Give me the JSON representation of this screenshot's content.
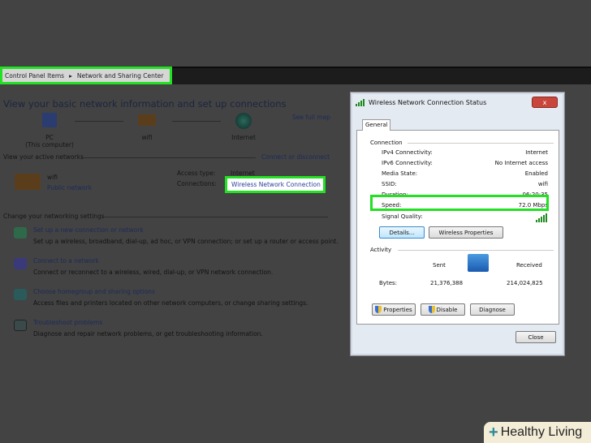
{
  "breadcrumb": {
    "items": [
      "Control Panel Items",
      "Network and Sharing Center"
    ]
  },
  "main": {
    "title": "View your basic network information and set up connections",
    "map": {
      "nodes": [
        {
          "label": "PC",
          "sub": "(This computer)"
        },
        {
          "label": "wifi"
        },
        {
          "label": "Internet"
        }
      ],
      "see_full_map": "See full map"
    },
    "active": {
      "heading": "View your active networks",
      "connect_link": "Connect or disconnect",
      "network_name": "wifi",
      "network_type": "Public network",
      "access_label": "Access type:",
      "access_value": "Internet",
      "connections_label": "Connections:",
      "connection_link": "Wireless Network Connection"
    },
    "change": {
      "heading": "Change your networking settings",
      "items": [
        {
          "title": "Set up a new connection or network",
          "desc": "Set up a wireless, broadband, dial-up, ad hoc, or VPN connection; or set up a router or access point."
        },
        {
          "title": "Connect to a network",
          "desc": "Connect or reconnect to a wireless, wired, dial-up, or VPN network connection."
        },
        {
          "title": "Choose homegroup and sharing options",
          "desc": "Access files and printers located on other network computers, or change sharing settings."
        },
        {
          "title": "Troubleshoot problems",
          "desc": "Diagnose and repair network problems, or get troubleshooting information."
        }
      ]
    }
  },
  "dialog": {
    "title": "Wireless Network Connection Status",
    "close_x": "x",
    "tab": "General",
    "connection_heading": "Connection",
    "rows": [
      {
        "label": "IPv4 Connectivity:",
        "value": "Internet"
      },
      {
        "label": "IPv6 Connectivity:",
        "value": "No Internet access"
      },
      {
        "label": "Media State:",
        "value": "Enabled"
      },
      {
        "label": "SSID:",
        "value": "wifi"
      },
      {
        "label": "Duration:",
        "value": "06:20:35"
      },
      {
        "label": "Speed:",
        "value": "72.0 Mbps"
      }
    ],
    "signal_label": "Signal Quality:",
    "signal_bars": 5,
    "details_btn": "Details...",
    "wireless_props_btn": "Wireless Properties",
    "activity_heading": "Activity",
    "sent": "Sent",
    "received": "Received",
    "bytes_label": "Bytes:",
    "bytes_sent": "21,376,388",
    "bytes_received": "214,024,825",
    "properties_btn": "Properties",
    "disable_btn": "Disable",
    "diagnose_btn": "Diagnose",
    "close_btn": "Close"
  },
  "watermark": {
    "text": "Healthy Living"
  }
}
